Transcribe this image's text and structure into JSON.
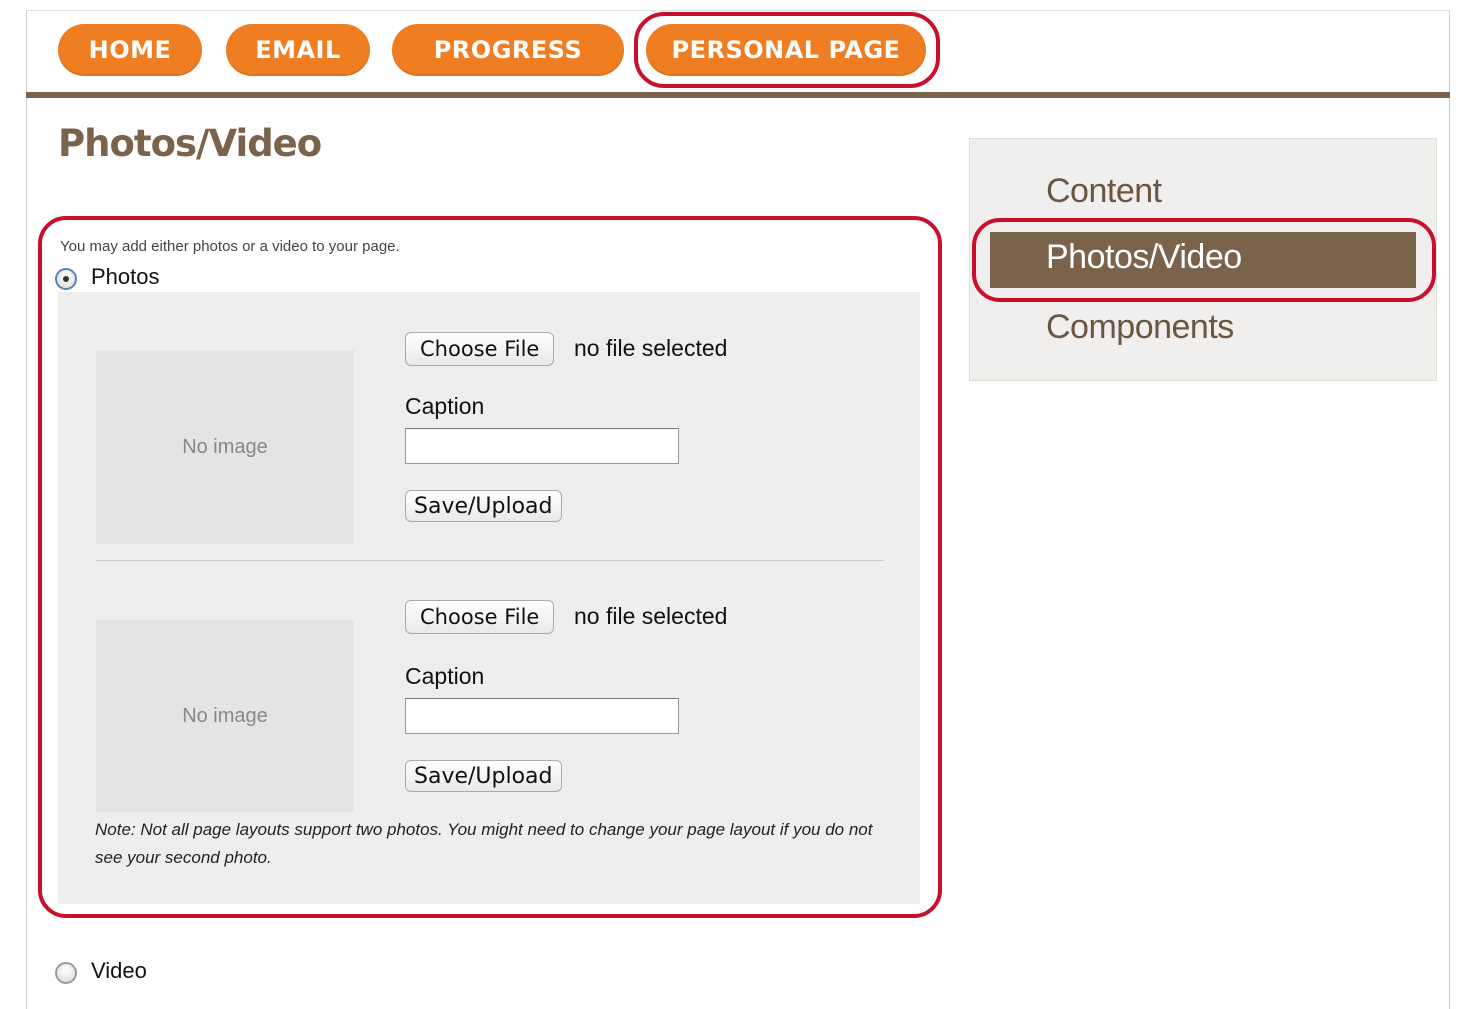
{
  "nav": {
    "items": [
      {
        "label": "HOME"
      },
      {
        "label": "EMAIL"
      },
      {
        "label": "PROGRESS"
      },
      {
        "label": "PERSONAL PAGE"
      }
    ],
    "color": "#ef7d22"
  },
  "page": {
    "title": "Photos/Video",
    "intro": "You may add either photos or a video to your page.",
    "photos_option": {
      "label": "Photos",
      "selected": true
    },
    "video_option": {
      "label": "Video",
      "selected": false
    }
  },
  "uploads": [
    {
      "placeholder": "No image",
      "choose_label": "Choose File",
      "file_status": "no file selected",
      "caption_label": "Caption",
      "caption_value": "",
      "save_label": "Save/Upload"
    },
    {
      "placeholder": "No image",
      "choose_label": "Choose File",
      "file_status": "no file selected",
      "caption_label": "Caption",
      "caption_value": "",
      "save_label": "Save/Upload"
    }
  ],
  "note": "Note: Not all page layouts support two photos. You might need to change your page layout if you do not see your second photo.",
  "sidebar": {
    "items": [
      {
        "label": "Content"
      },
      {
        "label": "Photos/Video",
        "active": true
      },
      {
        "label": "Components"
      }
    ],
    "active_color": "#7a634a"
  },
  "highlight_color": "#c8102e"
}
